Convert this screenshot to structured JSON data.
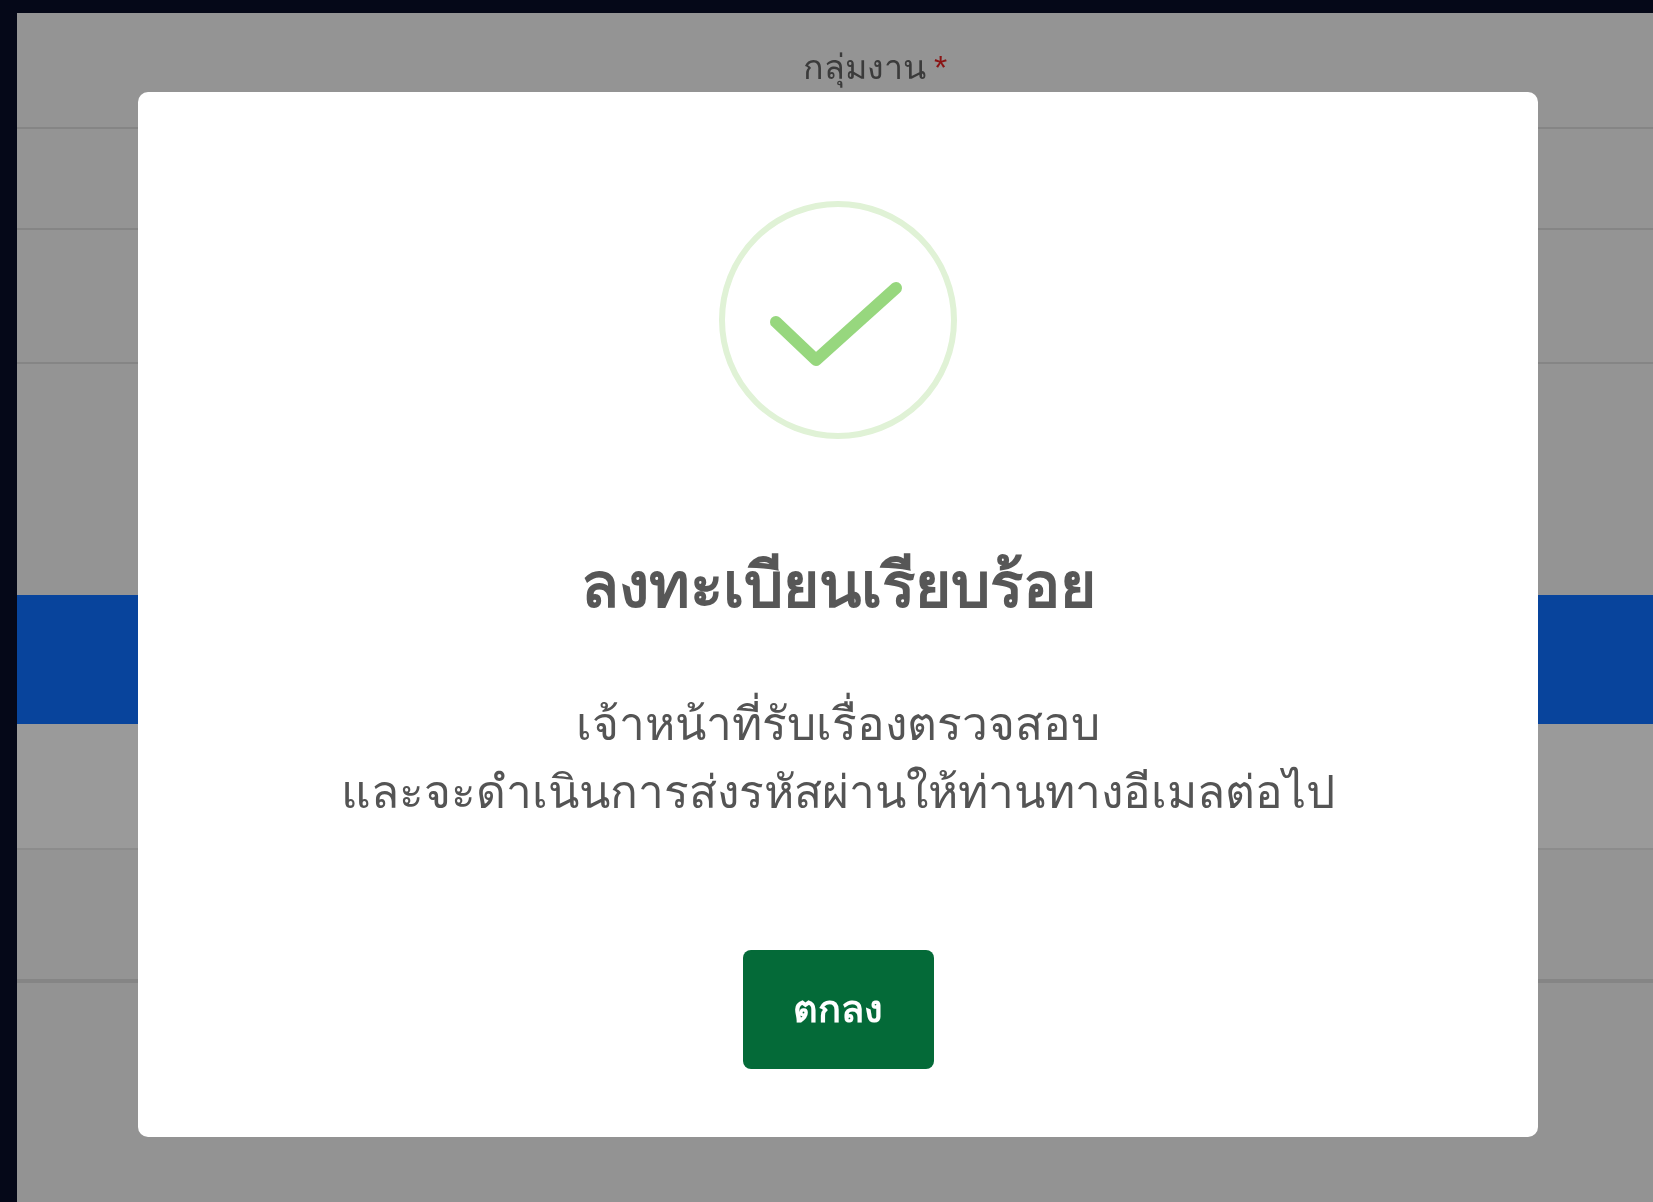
{
  "background_form": {
    "field_label": "กลุ่มงาน",
    "required_mark": "*"
  },
  "dialog": {
    "title": "ลงทะเบียนเรียบร้อย",
    "message_lines": [
      "เจ้าหน้าที่รับเรื่องตรวจสอบ",
      "และจะดำเนินการส่งรหัสผ่านให้ท่านทางอีเมลต่อไป"
    ],
    "button": "ตกลง"
  }
}
